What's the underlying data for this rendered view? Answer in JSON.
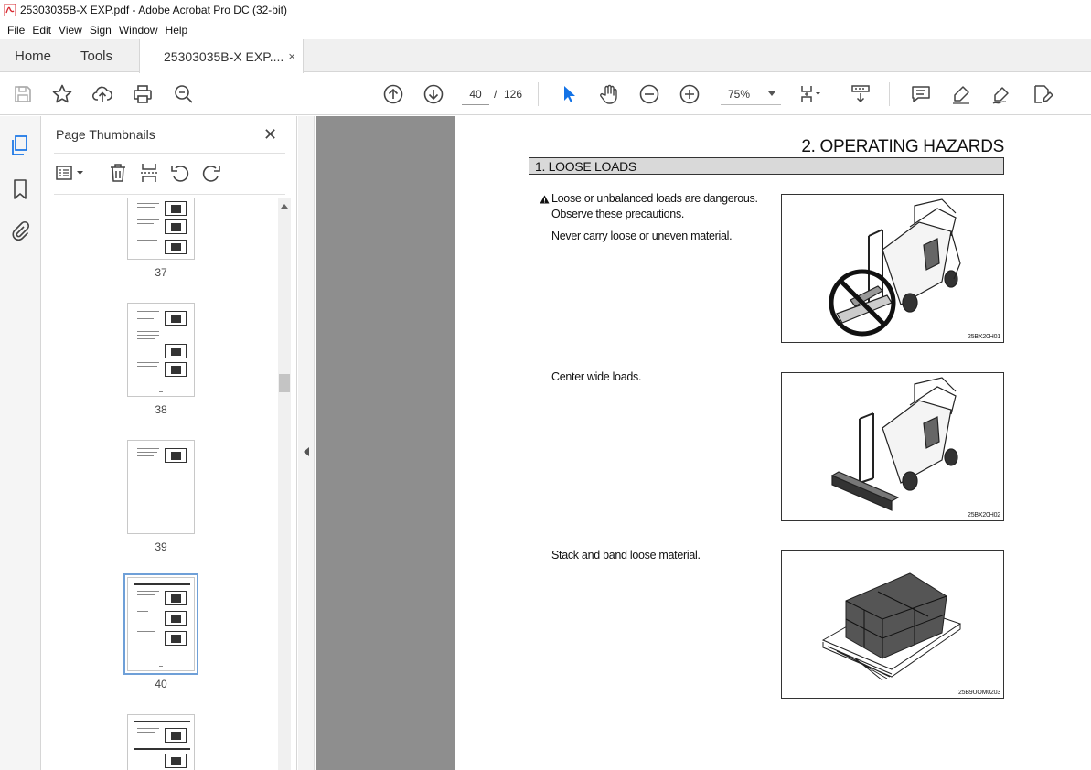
{
  "window": {
    "title": "25303035B-X EXP.pdf - Adobe Acrobat Pro DC (32-bit)"
  },
  "menu": [
    "File",
    "Edit",
    "View",
    "Sign",
    "Window",
    "Help"
  ],
  "tabs": {
    "home": "Home",
    "tools": "Tools",
    "document": "25303035B-X EXP....",
    "close": "×"
  },
  "toolbar": {
    "page_current": "40",
    "page_separator": "/",
    "page_total": "126",
    "zoom": "75%"
  },
  "thumbnails_panel": {
    "title": "Page Thumbnails",
    "close": "✕",
    "pages": [
      {
        "number": "37",
        "selected": false
      },
      {
        "number": "38",
        "selected": false
      },
      {
        "number": "39",
        "selected": false
      },
      {
        "number": "40",
        "selected": true
      },
      {
        "number": "",
        "selected": false
      }
    ]
  },
  "document": {
    "chapter_heading": "2. OPERATING HAZARDS",
    "section_title": "1. LOOSE LOADS",
    "blocks": [
      {
        "lines": [
          "Loose or unbalanced loads are dangerous.",
          "Observe these precautions.",
          "Never carry loose or uneven material."
        ],
        "figure_code": "25BX20H01"
      },
      {
        "lines": [
          "Center wide loads."
        ],
        "figure_code": "25BX20H02"
      },
      {
        "lines": [
          "Stack and band loose material."
        ],
        "figure_code": "25B9UOM0203"
      }
    ]
  },
  "colors": {
    "accent_blue": "#1473e6",
    "pdf_red": "#d7282f",
    "section_bar": "#d9d9d9"
  }
}
